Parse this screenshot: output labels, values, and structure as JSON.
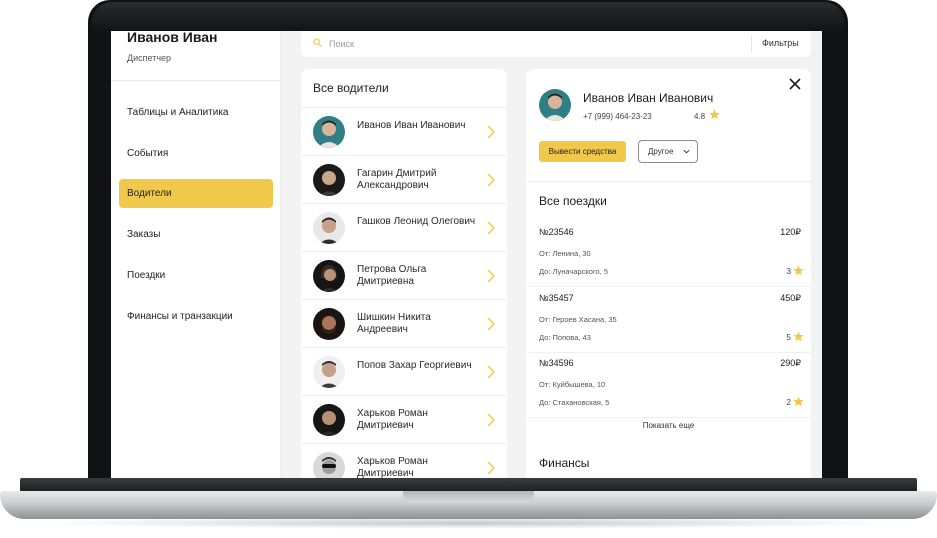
{
  "user": {
    "name": "Иванов Иван",
    "role": "Диспетчер"
  },
  "sidebar": {
    "items": [
      {
        "label": "Таблицы и Аналитика",
        "active": false
      },
      {
        "label": "События",
        "active": false
      },
      {
        "label": "Водители",
        "active": true
      },
      {
        "label": "Заказы",
        "active": false
      },
      {
        "label": "Поездки",
        "active": false
      },
      {
        "label": "Финансы и транзакции",
        "active": false
      }
    ]
  },
  "search": {
    "placeholder": "Поиск",
    "filters_label": "Фильтры"
  },
  "drivers": {
    "title": "Все водители",
    "items": [
      {
        "name": "Иванов Иван Иванович",
        "avatar": "teal"
      },
      {
        "name": "Гагарин Дмитрий Александрович",
        "avatar": "dark"
      },
      {
        "name": "Гашков Леонид Олегович",
        "avatar": "light"
      },
      {
        "name": "Петрова Ольга Дмитриевна",
        "avatar": "dark"
      },
      {
        "name": "Шишкин Никита Андреевич",
        "avatar": "warm"
      },
      {
        "name": "Попов Захар Георгиевич",
        "avatar": "light"
      },
      {
        "name": "Харьков Роман Дмитриевич",
        "avatar": "dark"
      },
      {
        "name": "Харьков Роман Дмитриевич",
        "avatar": "mono"
      }
    ]
  },
  "detail": {
    "name": "Иванов Иван Иванович",
    "phone": "+7 (999) 464-23-23",
    "rating": "4.8",
    "withdraw_label": "Вывести средства",
    "other_label": "Другое",
    "trips_title": "Все поездки",
    "trips": [
      {
        "id": "№23546",
        "price": "120₽",
        "from_label": "От:",
        "from": "Ленина, 30",
        "to_label": "До:",
        "to": "Луначарского, 5",
        "rating": "3"
      },
      {
        "id": "№35457",
        "price": "450₽",
        "from_label": "От:",
        "from": "Героев Хасана, 35",
        "to_label": "До:",
        "to": "Попова, 43",
        "rating": "5"
      },
      {
        "id": "№34596",
        "price": "290₽",
        "from_label": "От:",
        "from": "Куйбышева, 10",
        "to_label": "До:",
        "to": "Стахановская, 5",
        "rating": "2"
      }
    ],
    "show_more_label": "Показать еще",
    "finance_title": "Финансы"
  },
  "colors": {
    "accent": "#f0c94a",
    "background": "#f2f2f2",
    "panel": "#ffffff",
    "bezel": "#111214"
  }
}
